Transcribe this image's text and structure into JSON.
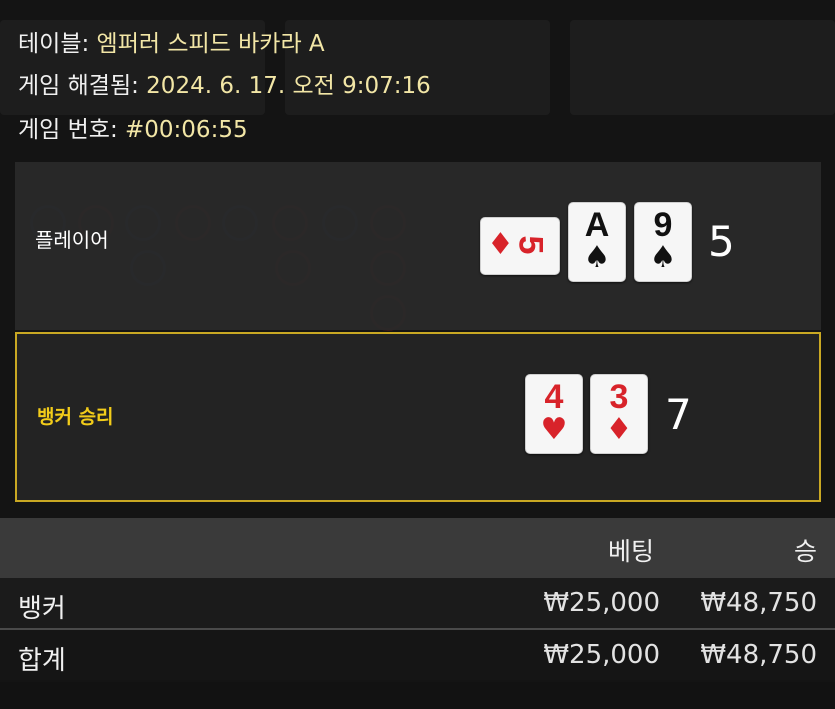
{
  "info": {
    "table_label": "테이블: ",
    "table_value": "엠퍼러 스피드 바카라 A",
    "resolved_label": "게임 해결됨: ",
    "resolved_value": "2024. 6. 17. 오전 9:07:16",
    "number_label": "게임 번호: ",
    "number_value": "#00:06:55"
  },
  "player": {
    "label": "플레이어",
    "score": "5",
    "cards": [
      {
        "rank": "5",
        "suit": "♦",
        "color": "red",
        "orientation": "horizontal"
      },
      {
        "rank": "A",
        "suit": "♠",
        "color": "black",
        "orientation": "vertical"
      },
      {
        "rank": "9",
        "suit": "♠",
        "color": "black",
        "orientation": "vertical"
      }
    ]
  },
  "banker": {
    "label": "뱅커 승리",
    "score": "7",
    "cards": [
      {
        "rank": "4",
        "suit": "♥",
        "color": "red",
        "orientation": "vertical"
      },
      {
        "rank": "3",
        "suit": "♦",
        "color": "red",
        "orientation": "vertical"
      }
    ]
  },
  "results_table": {
    "headers": [
      "",
      "베팅",
      "승"
    ],
    "rows": [
      {
        "label": "뱅커",
        "bet": "₩25,000",
        "win": "₩48,750"
      },
      {
        "label": "합계",
        "bet": "₩25,000",
        "win": "₩48,750"
      }
    ]
  },
  "colors": {
    "banker_accent": "#f2cc1a",
    "card_red": "#d8232a",
    "card_black": "#111111",
    "info_value": "#f2e6a6"
  }
}
